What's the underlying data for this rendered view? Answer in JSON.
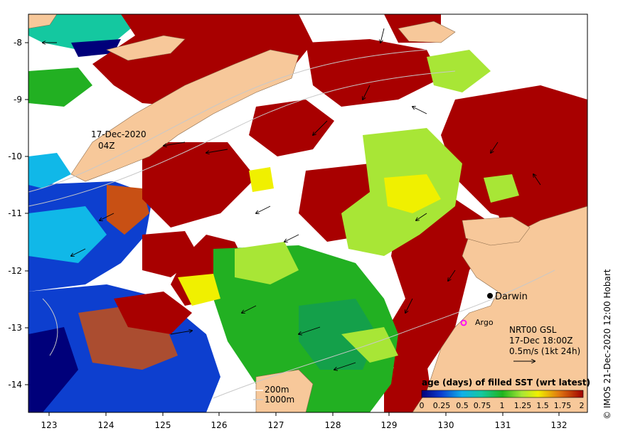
{
  "map": {
    "lon_ticks": [
      "123",
      "124",
      "125",
      "126",
      "127",
      "128",
      "129",
      "130",
      "131",
      "132"
    ],
    "lat_ticks": [
      "-8",
      "-9",
      "-10",
      "-11",
      "-12",
      "-13",
      "-14"
    ],
    "pass_label_line1": "17-Dec-2020",
    "pass_label_line2": "04Z",
    "city_label": "Darwin",
    "argo_label": "Argo",
    "current_info": {
      "line1": "NRT00 GSL",
      "line2": "17-Dec 18:00Z",
      "line3": "0.5m/s (1kt 24h)"
    },
    "depth_legend": {
      "line1": "200m",
      "line2": "1000m"
    },
    "colorbar": {
      "title": "age (days) of filled SST (wrt latest)",
      "ticks": [
        "0",
        "0.25",
        "0.5",
        "0.75",
        "1",
        "1.25",
        "1.5",
        "1.75",
        "2"
      ]
    },
    "credit": "© IMOS 21-Dec-2020 12:00 Hobart",
    "colors": {
      "land": "#f7c89a",
      "recent": "#a80000",
      "green": "#22b022",
      "lime": "#a8e636",
      "yellow": "#f0f000",
      "blue": "#0d3fcf",
      "cyan": "#10b8e8",
      "orange": "#c85014",
      "argo": "#ff00ff"
    }
  }
}
